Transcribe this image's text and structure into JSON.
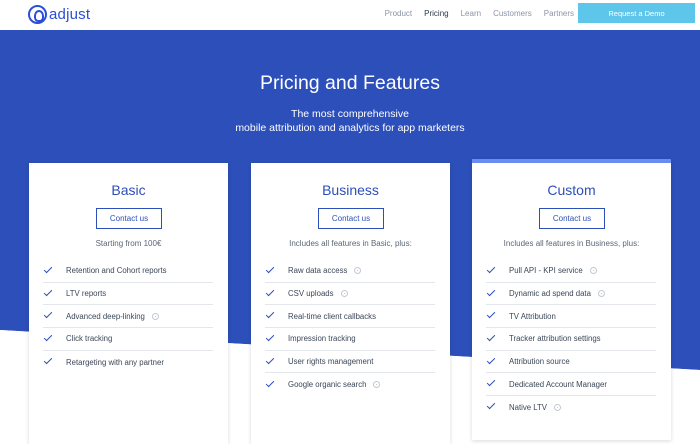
{
  "nav": {
    "logo_text": "adjust",
    "links": [
      "Product",
      "Pricing",
      "Learn",
      "Customers",
      "Partners"
    ],
    "demo_label": "Request a Demo"
  },
  "hero": {
    "title": "Pricing and Features",
    "subtitle_line1": "The most comprehensive",
    "subtitle_line2": "mobile attribution and analytics for app marketers"
  },
  "plans": [
    {
      "name": "Basic",
      "cta": "Contact us",
      "intro": "Starting from 100€",
      "features": [
        {
          "label": "Retention and Cohort reports",
          "info": false
        },
        {
          "label": "LTV reports",
          "info": false
        },
        {
          "label": "Advanced deep-linking",
          "info": true
        },
        {
          "label": "Click tracking",
          "info": false
        },
        {
          "label": "Retargeting with any partner",
          "info": false
        }
      ]
    },
    {
      "name": "Business",
      "cta": "Contact us",
      "intro": "Includes all features in Basic, plus:",
      "features": [
        {
          "label": "Raw data access",
          "info": true
        },
        {
          "label": "CSV uploads",
          "info": true
        },
        {
          "label": "Real-time client callbacks",
          "info": false
        },
        {
          "label": "Impression tracking",
          "info": false
        },
        {
          "label": "User rights management",
          "info": false
        },
        {
          "label": "Google organic search",
          "info": true
        }
      ]
    },
    {
      "name": "Custom",
      "cta": "Contact us",
      "intro": "Includes all features in Business, plus:",
      "features": [
        {
          "label": "Pull API - KPI service",
          "info": true
        },
        {
          "label": "Dynamic ad spend data",
          "info": true
        },
        {
          "label": "TV Attribution",
          "info": false
        },
        {
          "label": "Tracker attribution settings",
          "info": false
        },
        {
          "label": "Attribution source",
          "info": false
        },
        {
          "label": "Dedicated Account Manager",
          "info": false
        },
        {
          "label": "Native LTV",
          "info": true
        }
      ]
    }
  ],
  "colors": {
    "brand_blue": "#2c4fba",
    "demo_button": "#5ec6ea",
    "custom_accent": "#6b8cf0"
  }
}
